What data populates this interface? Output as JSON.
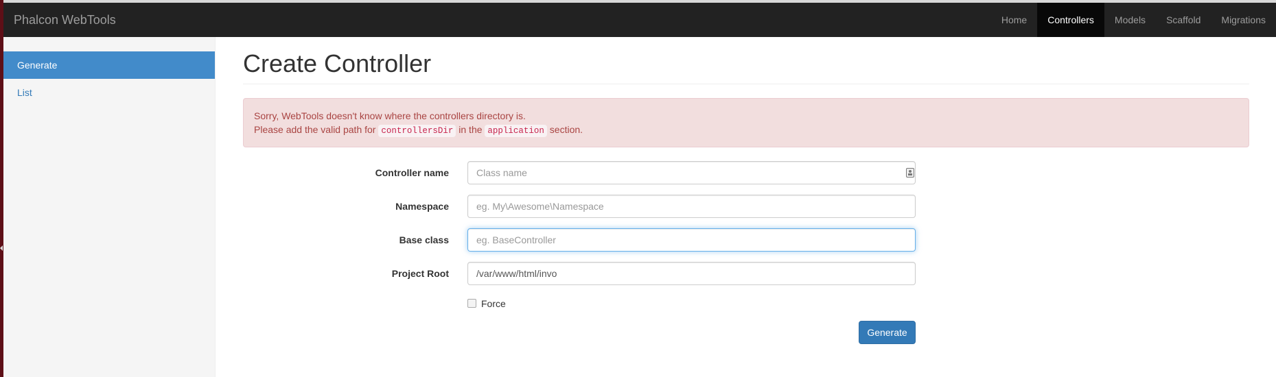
{
  "navbar": {
    "brand": "Phalcon WebTools",
    "items": [
      {
        "label": "Home",
        "active": false
      },
      {
        "label": "Controllers",
        "active": true
      },
      {
        "label": "Models",
        "active": false
      },
      {
        "label": "Scaffold",
        "active": false
      },
      {
        "label": "Migrations",
        "active": false
      }
    ]
  },
  "sidebar": {
    "items": [
      {
        "label": "Generate",
        "active": true
      },
      {
        "label": "List",
        "active": false
      }
    ]
  },
  "main": {
    "title": "Create Controller",
    "alert": {
      "line1": "Sorry, WebTools doesn't know where the controllers directory is.",
      "line2_prefix": "Please add the valid path for ",
      "code1": "controllersDir",
      "line2_middle": " in the ",
      "code2": "application",
      "line2_suffix": " section."
    },
    "form": {
      "controller_name": {
        "label": "Controller name",
        "value": "",
        "placeholder": "Class name",
        "icon": "contact-card-icon"
      },
      "namespace": {
        "label": "Namespace",
        "value": "",
        "placeholder": "eg. My\\Awesome\\Namespace"
      },
      "base_class": {
        "label": "Base class",
        "value": "",
        "placeholder": "eg. BaseController",
        "focused": true
      },
      "project_root": {
        "label": "Project Root",
        "value": "/var/www/html/invo",
        "placeholder": ""
      },
      "force": {
        "label": "Force",
        "checked": false
      },
      "submit_label": "Generate"
    }
  }
}
